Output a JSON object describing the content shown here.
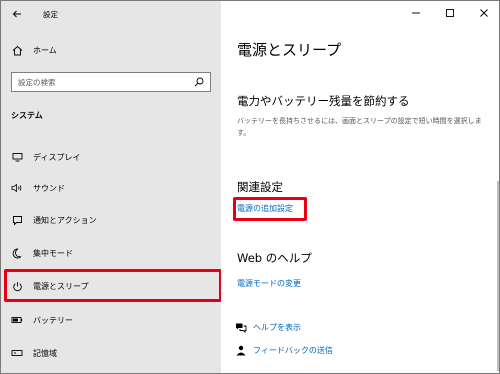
{
  "window": {
    "title": "設定",
    "controls": [
      "minimize-icon",
      "maximize-icon",
      "close-icon"
    ]
  },
  "sidebar": {
    "home_label": "ホーム",
    "search_placeholder": "設定の検索",
    "section_label": "システム",
    "items": [
      {
        "label": "ディスプレイ",
        "icon": "display-icon"
      },
      {
        "label": "サウンド",
        "icon": "speaker-icon"
      },
      {
        "label": "通知とアクション",
        "icon": "notification-icon"
      },
      {
        "label": "集中モード",
        "icon": "moon-icon"
      },
      {
        "label": "電源とスリープ",
        "icon": "power-icon",
        "selected": true
      },
      {
        "label": "バッテリー",
        "icon": "battery-icon"
      },
      {
        "label": "記憶域",
        "icon": "storage-icon"
      }
    ]
  },
  "main": {
    "title": "電源とスリープ",
    "battery_section": {
      "heading": "電力やバッテリー残量を節約する",
      "description": "バッテリーを長持ちさせるには、画面とスリープの設定で短い時間を選択します。"
    },
    "related": {
      "heading": "関連設定",
      "link": "電源の追加設定"
    },
    "help": {
      "heading": "Web のヘルプ",
      "link": "電源モードの変更"
    },
    "help_links": [
      {
        "label": "ヘルプを表示",
        "icon": "help-chat-icon"
      },
      {
        "label": "フィードバックの送信",
        "icon": "feedback-icon"
      }
    ]
  },
  "colors": {
    "sidebar_bg": "#e6e6e6",
    "link": "#0067b8",
    "highlight": "#e60012"
  }
}
